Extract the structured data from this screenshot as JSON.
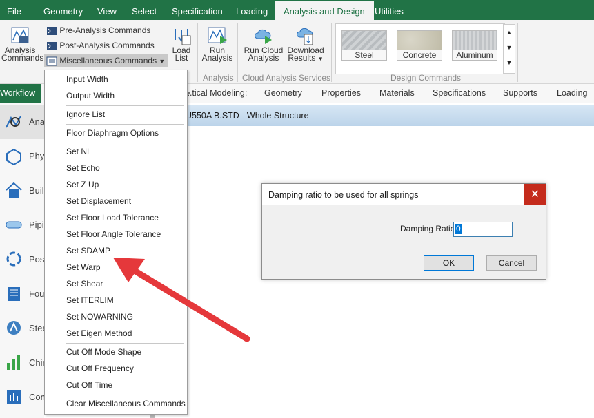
{
  "menubar": {
    "items": [
      "File",
      "Geometry",
      "View",
      "Select",
      "Specification",
      "Loading",
      "Analysis and Design",
      "Utilities"
    ],
    "active": "Analysis and Design"
  },
  "ribbon": {
    "analysis_commands": "Analysis Commands",
    "pre_analysis": "Pre-Analysis Commands",
    "post_analysis": "Post-Analysis Commands",
    "misc": "Miscellaneous Commands",
    "load_list": "Load List",
    "run_analysis": "Run Analysis",
    "group_analysis": "Analysis",
    "run_cloud": "Run Cloud Analysis",
    "download_results": "Download Results",
    "group_cloud": "Cloud Analysis Services",
    "steel": "Steel",
    "concrete": "Concrete",
    "aluminum": "Aluminum",
    "group_design": "Design Commands"
  },
  "workflow": {
    "label": "Workflow",
    "tabs": [
      "...tical Modeling:",
      "Geometry",
      "Properties",
      "Materials",
      "Specifications",
      "Supports",
      "Loading"
    ]
  },
  "sidebar": {
    "items": [
      "Ana",
      "Phy",
      "Buil",
      "Pipi",
      "Post",
      "Fou",
      "Stee",
      "Chin",
      "Con"
    ]
  },
  "structure_title": "U550A B.STD - Whole Structure",
  "dropdown": {
    "items": [
      "Input Width",
      "Output Width",
      "Ignore List",
      "Floor Diaphragm Options",
      "Set NL",
      "Set Echo",
      "Set Z Up",
      "Set Displacement",
      "Set Floor Load Tolerance",
      "Set Floor Angle Tolerance",
      "Set SDAMP",
      "Set Warp",
      "Set Shear",
      "Set ITERLIM",
      "Set NOWARNING",
      "Set Eigen Method",
      "Cut Off Mode Shape",
      "Cut Off Frequency",
      "Cut Off Time",
      "Clear Miscellaneous Commands"
    ]
  },
  "dialog": {
    "title": "Damping ratio to be used for all springs",
    "field_label": "Damping Ratio:",
    "field_value": "0",
    "ok": "OK",
    "cancel": "Cancel"
  },
  "colors": {
    "brand": "#217346",
    "arrow": "#e5383b",
    "close": "#c42b1c"
  }
}
